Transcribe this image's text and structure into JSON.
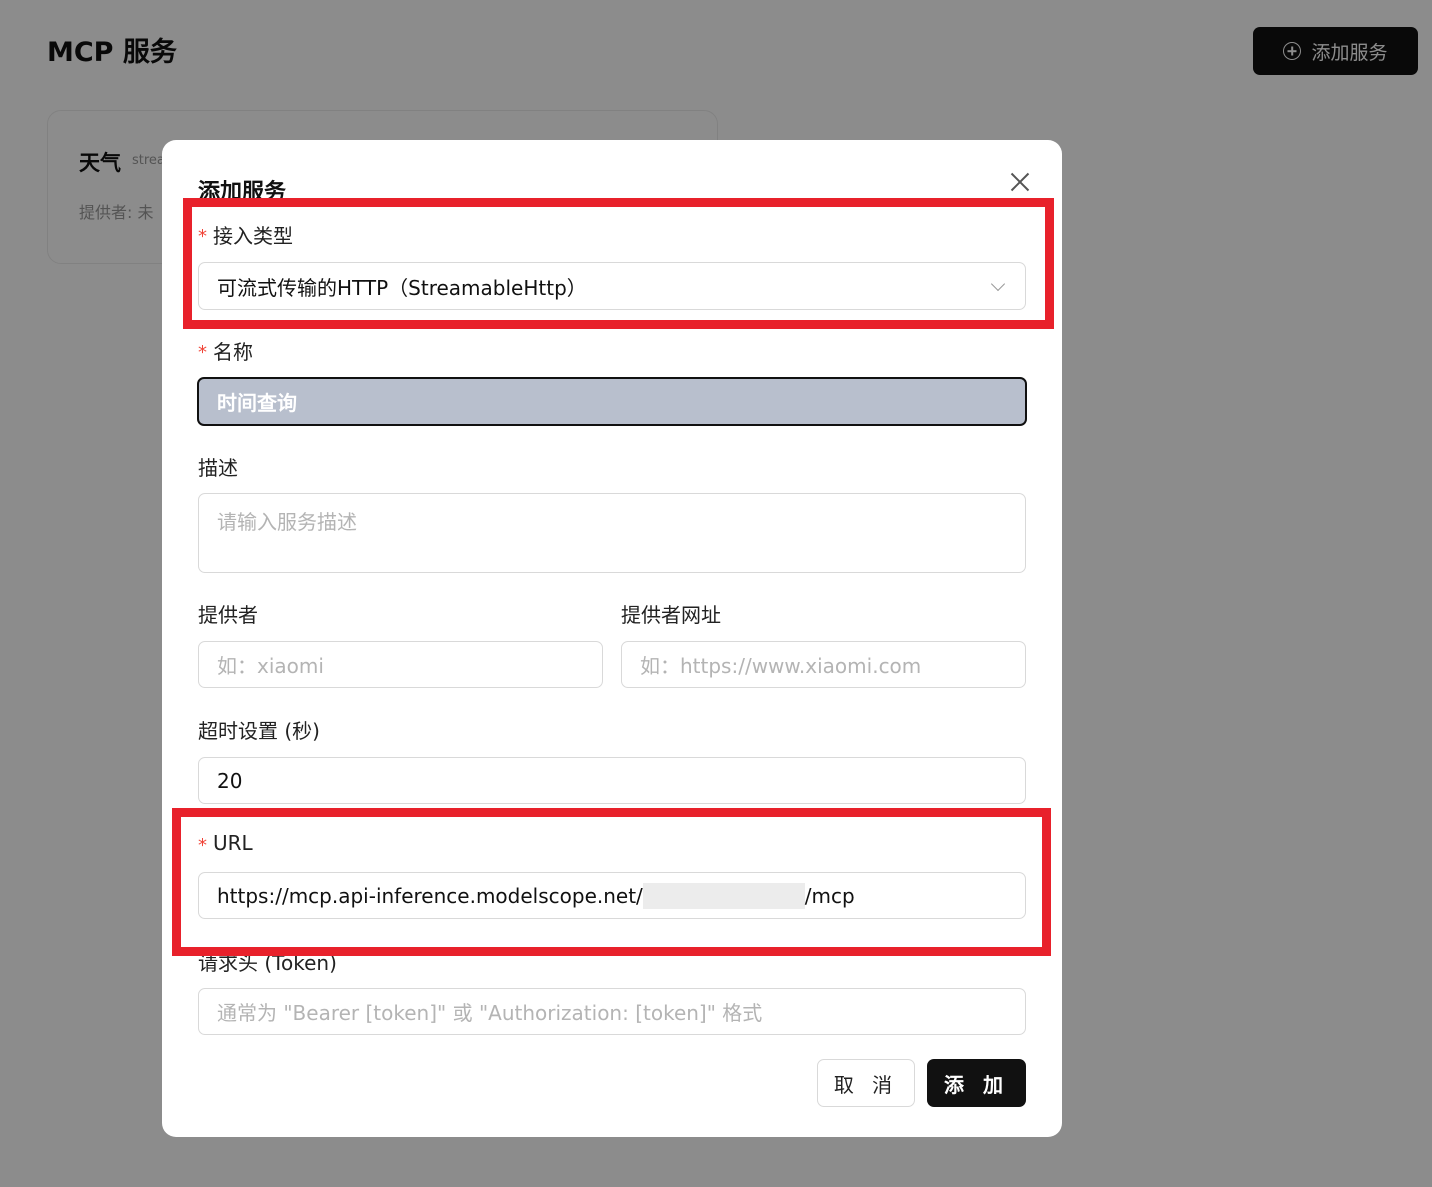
{
  "page": {
    "title": "MCP 服务",
    "add_button_label": "添加服务",
    "card": {
      "name": "天气",
      "tag": "strea",
      "provider": "提供者: 未"
    }
  },
  "modal": {
    "title": "添加服务",
    "access_type": {
      "label": "接入类型",
      "value": "可流式传输的HTTP（StreamableHttp）"
    },
    "name": {
      "label": "名称",
      "value": "时间查询"
    },
    "description": {
      "label": "描述",
      "placeholder": "请输入服务描述"
    },
    "provider": {
      "label": "提供者",
      "placeholder": "如：xiaomi"
    },
    "provider_url": {
      "label": "提供者网址",
      "placeholder": "如：https://www.xiaomi.com"
    },
    "timeout": {
      "label": "超时设置 (秒)",
      "value": "20"
    },
    "url": {
      "label": "URL",
      "value_prefix": "https://mcp.api-inference.modelscope.net/",
      "value_suffix": "/mcp"
    },
    "token": {
      "label": "请求头 (Token)",
      "placeholder": "通常为 \"Bearer [token]\" 或 \"Authorization: [token]\" 格式"
    },
    "cancel_label": "取 消",
    "submit_label": "添 加"
  },
  "colors": {
    "primary": "#111111",
    "required_mark": "#f04438",
    "highlight_box": "#e8212b",
    "focused_field_bg": "#b8bfcd"
  }
}
